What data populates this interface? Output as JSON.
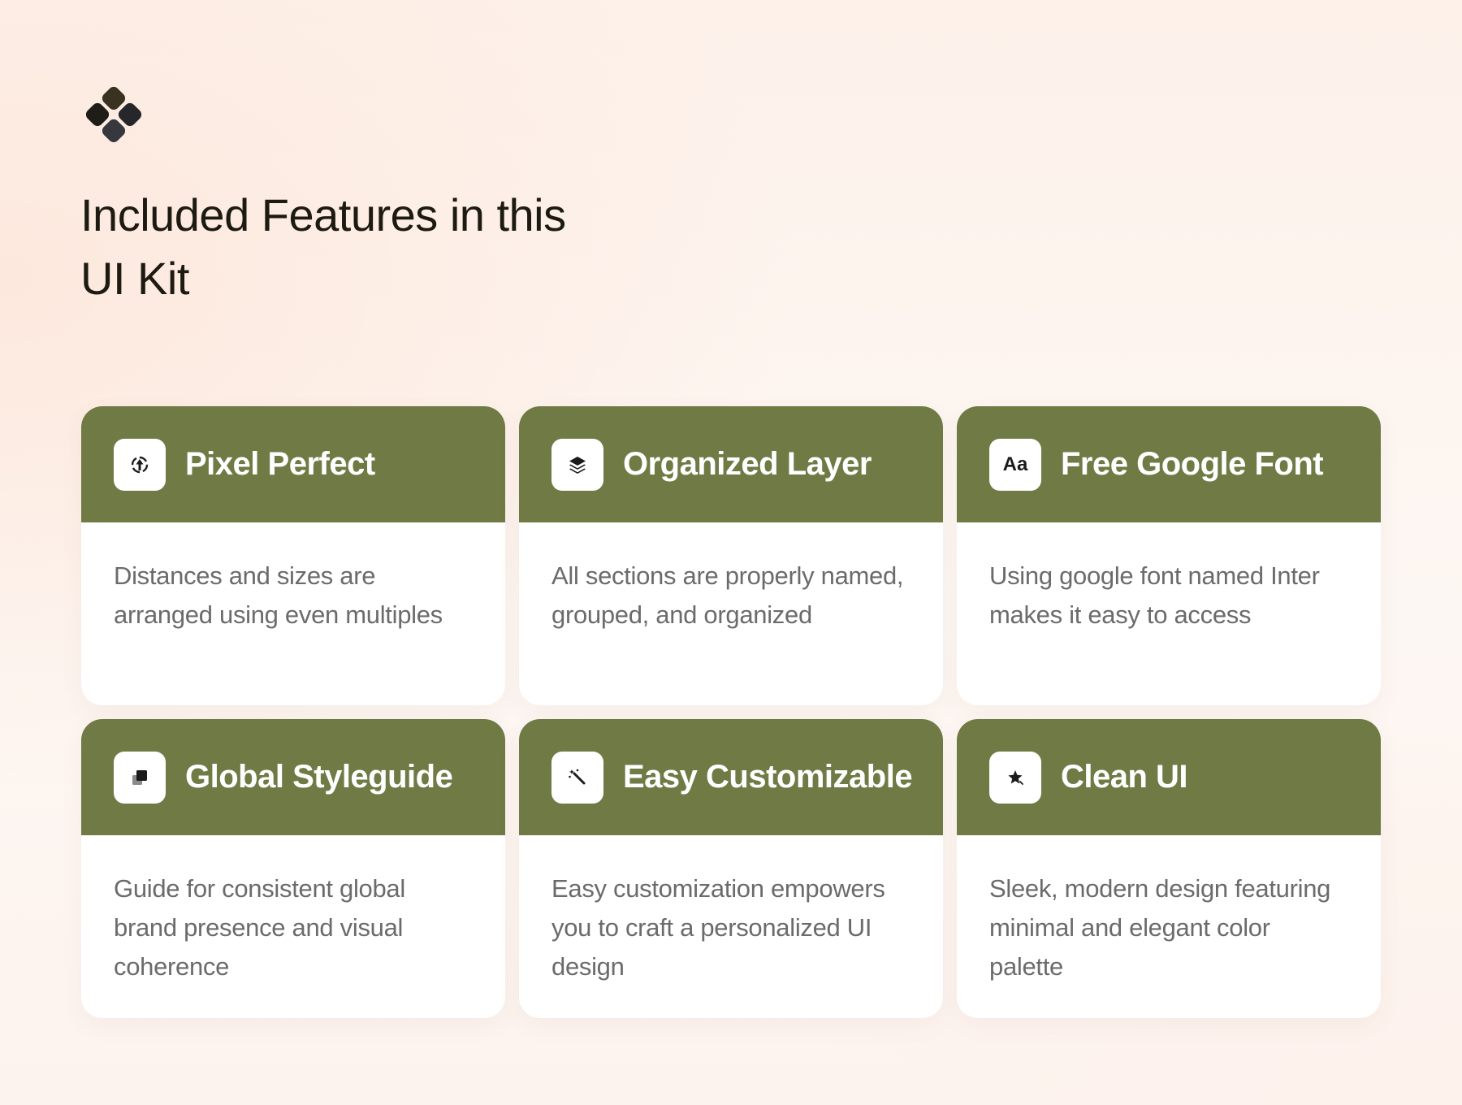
{
  "page": {
    "title": "Included Features in this UI Kit"
  },
  "colors": {
    "accent": "#6f7a45",
    "title_text": "#1d1a12",
    "body_text": "#6b6b6b",
    "card_bg": "#ffffff"
  },
  "features": [
    {
      "title": "Pixel Perfect",
      "icon": "target-icon",
      "description": "Distances and sizes are arranged using even multiples"
    },
    {
      "title": "Organized Layer",
      "icon": "layers-icon",
      "description": "All sections are properly named, grouped, and organized"
    },
    {
      "title": "Free Google Font",
      "icon": "font-icon",
      "icon_text": "Aa",
      "description": "Using google font named Inter makes it easy  to access"
    },
    {
      "title": "Global Styleguide",
      "icon": "stacked-squares-icon",
      "description": "Guide for consistent global brand presence and visual coherence"
    },
    {
      "title": "Easy Customizable",
      "icon": "magic-wand-icon",
      "description": "Easy customization empowers you to craft a personalized UI design"
    },
    {
      "title": "Clean UI",
      "icon": "sparkle-icon",
      "description": "Sleek, modern design featuring minimal and elegant color palette"
    }
  ]
}
